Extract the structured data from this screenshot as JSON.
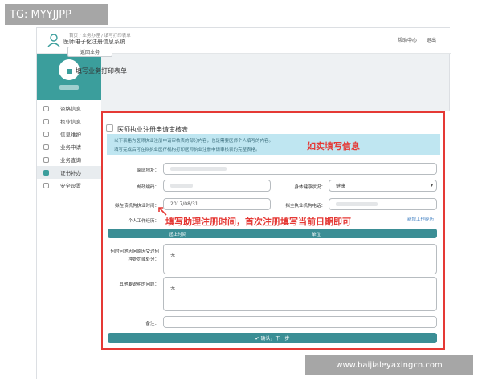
{
  "watermark_top": "TG: MYYJJPP",
  "watermark_bottom": "www.baijialeyaxingcn.com",
  "header": {
    "system_title": "医师电子化注册信息系统",
    "help_link": "帮助中心",
    "logout_link": "退出"
  },
  "sidebar": {
    "items": [
      {
        "label": "资格信息"
      },
      {
        "label": "执业信息"
      },
      {
        "label": "信息维护"
      },
      {
        "label": "业务申请"
      },
      {
        "label": "业务查询"
      },
      {
        "label": "证书补办"
      },
      {
        "label": "安全设置"
      }
    ]
  },
  "breadcrumb": "首页 / 业务办理 / 填写打印表单",
  "back_button": "返回业务",
  "section_title": "填写业务打印表单",
  "form": {
    "heading": "医师执业注册申请审核表",
    "notice_line1": "以下表格为医师执业注册申请审核表的部分内容，也是需要医师个人填写的内容。",
    "notice_line2": "填写完成后可在拟执业医疗机构打印医师执业注册申请审核表的完整表格。",
    "address_label": "家庭地址：",
    "postcode_label": "邮政编码：",
    "health_label": "身体健康状况：",
    "health_value": "健康",
    "join_time_label": "拟在该机构执业时间：",
    "join_time_value": "2017/08/31",
    "org_phone_label": "拟主执业机构电话：",
    "work_history_label": "个人工作经历：",
    "add_work_link": "新增工作经历",
    "col_time": "起止时间",
    "col_unit": "单位",
    "penalty_label": "何时何地因何原因受过何种处罚或处分：",
    "penalty_value": "无",
    "other_label": "其他要说明的问题：",
    "other_value": "无",
    "remark_label": "备注：",
    "submit_button": "✔ 确认，下一步"
  },
  "annotations": {
    "fill_truthfully": "如实填写信息",
    "join_time_hint": "填写助理注册时间，首次注册填写当前日期即可"
  },
  "colors": {
    "teal": "#3b9e9c",
    "annotation_red": "#e53935",
    "notice_bg": "#bfe6f1"
  }
}
